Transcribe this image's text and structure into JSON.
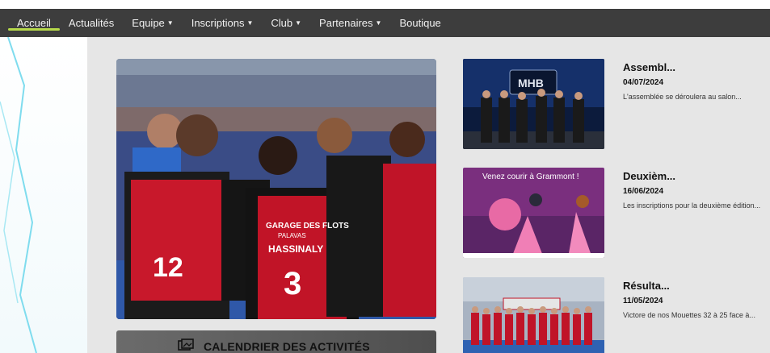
{
  "nav": {
    "items": [
      {
        "label": "Accueil",
        "has_menu": false,
        "active": true
      },
      {
        "label": "Actualités",
        "has_menu": false,
        "active": false
      },
      {
        "label": "Equipe",
        "has_menu": true,
        "active": false
      },
      {
        "label": "Inscriptions",
        "has_menu": true,
        "active": false
      },
      {
        "label": "Club",
        "has_menu": true,
        "active": false
      },
      {
        "label": "Partenaires",
        "has_menu": true,
        "active": false
      },
      {
        "label": "Boutique",
        "has_menu": false,
        "active": false
      }
    ],
    "active_underline_color": "#b6d94a",
    "background": "#3d3d3d"
  },
  "hero": {
    "jersey_text": {
      "line1": "GARAGE DES FLOTS",
      "line2": "PALAVAS",
      "player": "HASSINALY",
      "number": "3",
      "left_number": "12"
    }
  },
  "calendar": {
    "label": "CALENDRIER DES ACTIVITÉS",
    "icon": "calendar-photo-icon"
  },
  "news": [
    {
      "title": "Assembl...",
      "date": "04/07/2024",
      "excerpt": "L'assemblée se déroulera au salon...",
      "thumb_text": "MHB"
    },
    {
      "title": "Deuxièm...",
      "date": "16/06/2024",
      "excerpt": "Les inscriptions pour la deuxième édition...",
      "thumb_text": "Venez courir à Grammont !"
    },
    {
      "title": "Résulta...",
      "date": "11/05/2024",
      "excerpt": "Victore de nos Mouettes 32 à 25 face à..."
    }
  ]
}
